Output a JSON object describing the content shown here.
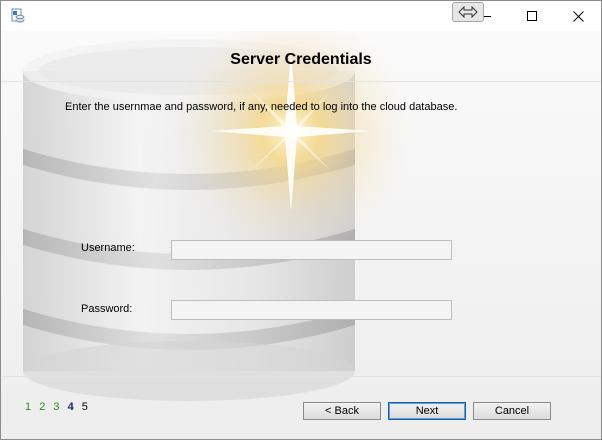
{
  "window": {
    "snap_icon": "snap-arrows-icon",
    "app_icon": "database-setup-icon"
  },
  "header": {
    "title": "Server Credentials"
  },
  "instructions": "Enter the usernmae and password, if any, needed to log into the cloud database.",
  "form": {
    "username_label": "Username:",
    "username_value": "",
    "password_label": "Password:",
    "password_value": ""
  },
  "steps": [
    {
      "label": "1",
      "state": "done"
    },
    {
      "label": "2",
      "state": "done"
    },
    {
      "label": "3",
      "state": "done"
    },
    {
      "label": "4",
      "state": "current"
    },
    {
      "label": "5",
      "state": "future"
    }
  ],
  "buttons": {
    "back": "< Back",
    "next": "Next",
    "cancel": "Cancel"
  },
  "colors": {
    "step_done": "#2e8b2e",
    "step_current": "#1a237e",
    "default_button_border": "#1c5fa8"
  }
}
